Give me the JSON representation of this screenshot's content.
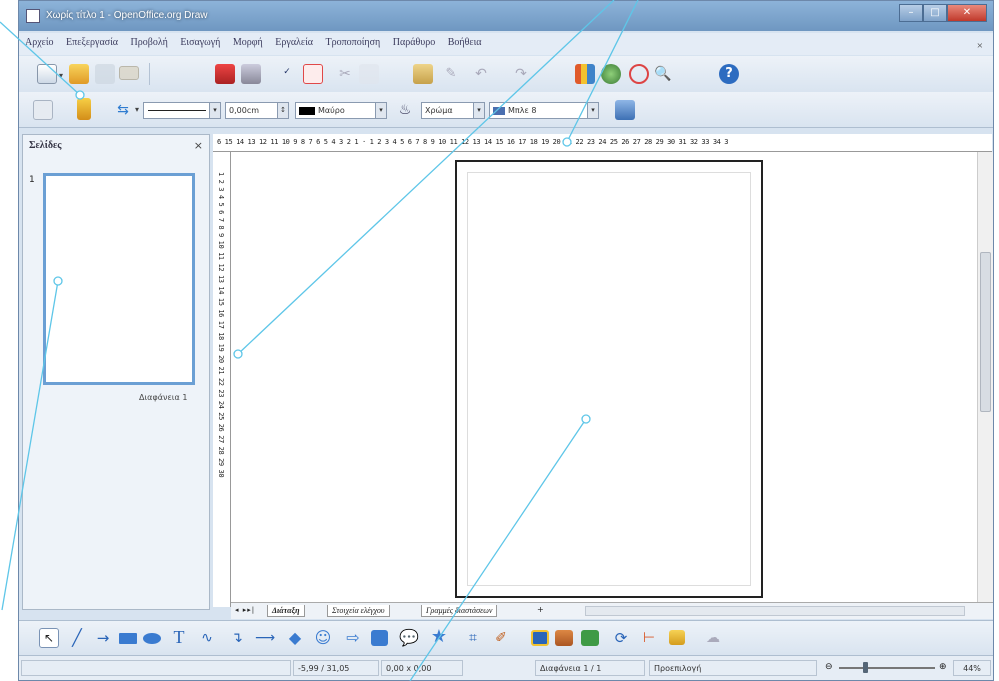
{
  "window": {
    "title": "Χωρίς τίτλο 1 - OpenOffice.org Draw",
    "controls": {
      "min": "–",
      "max": "□",
      "close": "✕"
    }
  },
  "menu": [
    "Αρχείο",
    "Επεξεργασία",
    "Προβολή",
    "Εισαγωγή",
    "Μορφή",
    "Εργαλεία",
    "Τροποποίηση",
    "Παράθυρο",
    "Βοήθεια"
  ],
  "menu_close": "×",
  "toolbar2": {
    "line_width": "0,00cm",
    "line_color": "Μαύρο",
    "area_style": "Χρώμα",
    "area_color": "Μπλε 8"
  },
  "pages_panel": {
    "title": "Σελίδες",
    "close": "×",
    "page_number": "1",
    "page_label": "Διαφάνεια 1"
  },
  "rulers": {
    "horizontal": "6 15 14 13 12 11 10 9 8 7 6 5 4 3 2 1 · 1 2 3 4 5 6 7 8 9 10 11 12 13 14 15 16 17 18 19 20 21 22 23 24 25 26 27 28 29 30 31 32 33 34 3",
    "vertical": "1 2 3 4 5 6 7 8 9 10 11 12 13 14 15 16 17 18 19 20 21 22 23 24 25 26 27 28 29 30"
  },
  "tabs": {
    "nav": "◂ ▸▸|",
    "items": [
      "Διάταξη",
      "Στοιχεία ελέγχου",
      "Γραμμές διαστάσεων"
    ],
    "add": "+"
  },
  "status": {
    "position": "-5,99 / 31,05",
    "size": "0,00 x 0,00",
    "page": "Διαφάνεια 1 / 1",
    "master": "Προεπιλογή",
    "zoom": "44%",
    "zoom_minus": "⊖",
    "zoom_plus": "⊕"
  },
  "colors": {
    "accent": "#6b9fd4",
    "callout": "#5ec6e8",
    "titlebar": "#7ea6cf"
  },
  "icons": [
    "new-icon",
    "open-icon",
    "save-icon",
    "email-icon",
    "pdf-icon",
    "print-icon",
    "spellcheck-icon",
    "autospell-icon",
    "cut-icon",
    "copy-icon",
    "paste-icon",
    "clone-icon",
    "undo-icon",
    "redo-icon",
    "chart-icon",
    "navigator-icon",
    "gallery-icon",
    "zoom-icon",
    "help-icon",
    "select-icon",
    "line-icon",
    "arrow-icon",
    "rectangle-icon",
    "ellipse-icon",
    "text-icon",
    "curve-icon",
    "connector-icon",
    "lines-arrows-icon",
    "basic-shapes-icon",
    "symbol-shapes-icon",
    "block-arrows-icon",
    "flowchart-icon",
    "callouts-icon",
    "stars-icon",
    "points-icon",
    "glue-points-icon",
    "fontwork-icon",
    "from-file-icon",
    "extrusion-icon",
    "rotate-icon",
    "align-icon",
    "arrange-icon",
    "shadow-icon"
  ]
}
